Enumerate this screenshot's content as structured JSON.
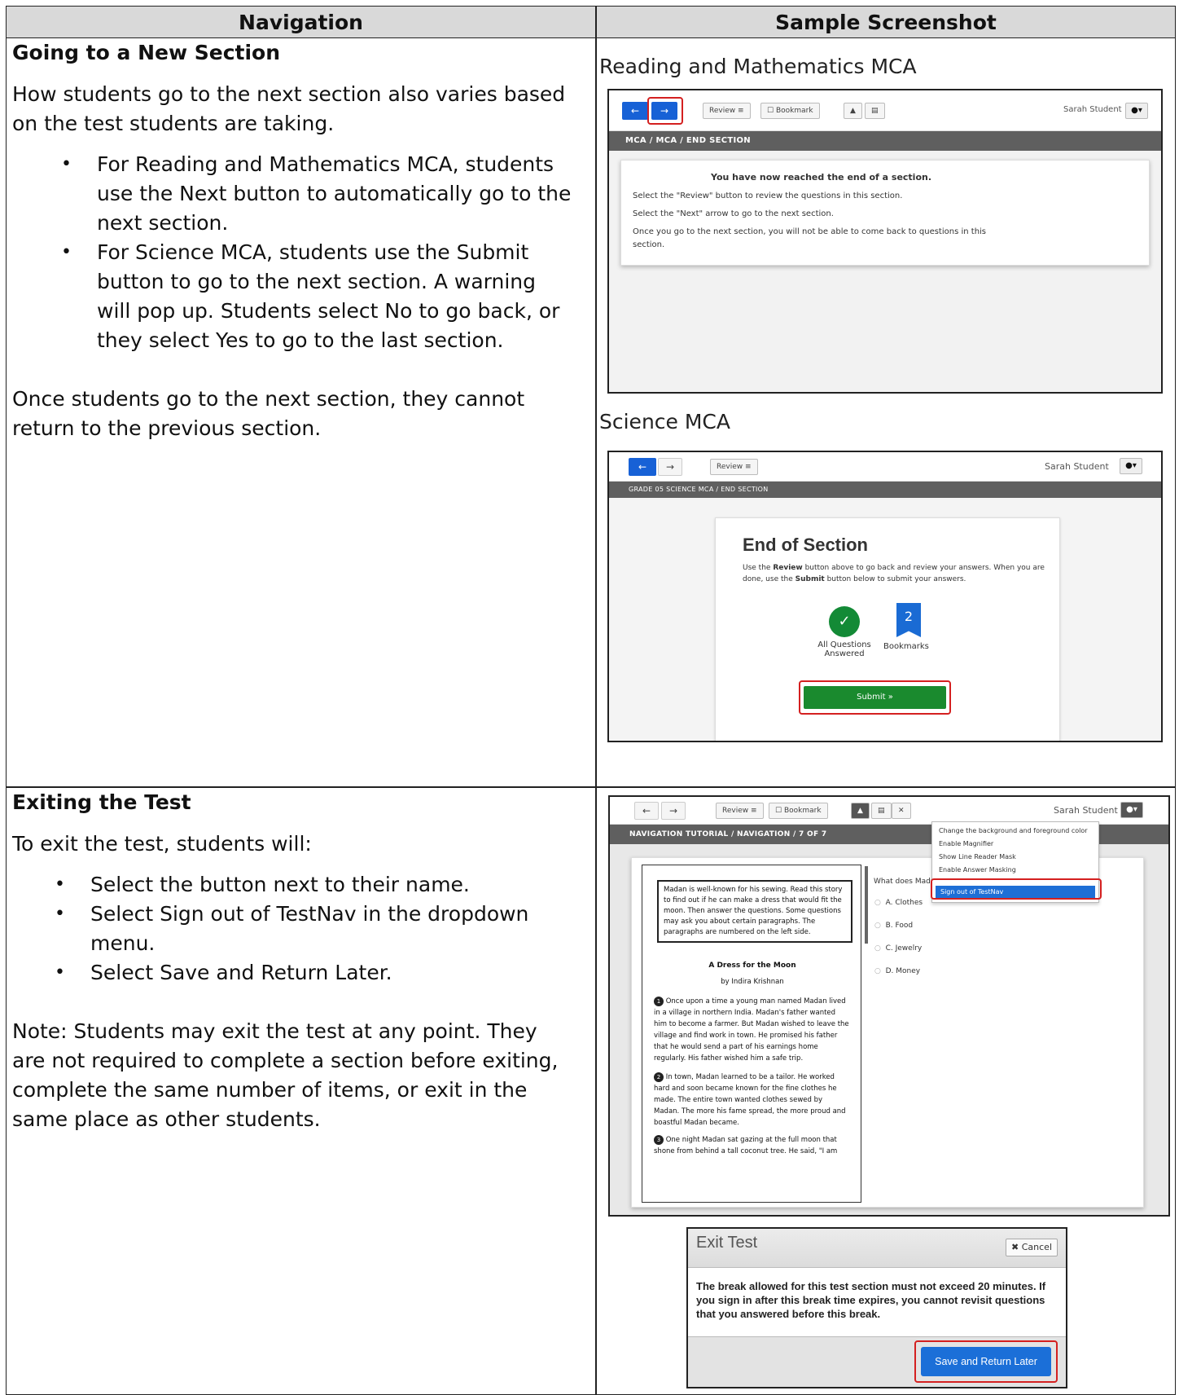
{
  "header": {
    "col1": "Navigation",
    "col2": "Sample Screenshot"
  },
  "section1": {
    "title": "Going to a New Section",
    "intro": "How students go to the next section also varies based on the test students are taking.",
    "bullets": [
      "For Reading and Mathematics MCA, students use the Next button to automatically go to the next section.",
      "For Science MCA, students use the Submit button to go to the next section. A warning will pop up. Students select No to go back, or they select Yes to go to the last section."
    ],
    "outro": "Once students go to the next section, they cannot return to the previous section.",
    "caption1": "Reading and Mathematics MCA",
    "caption2": "Science MCA"
  },
  "shot1": {
    "review": "Review",
    "bookmark": "Bookmark",
    "user": "Sarah Student",
    "breadcrumb": "MCA / MCA / END SECTION",
    "title": "You have now reached the end of a section.",
    "line1": "Select the \"Review\" button to review the questions in this section.",
    "line2": "Select the \"Next\" arrow to go to the next section.",
    "line3": "Once you go to the next section, you will not be able to come back to questions in this",
    "line4": "section."
  },
  "shot2": {
    "review": "Review",
    "user": "Sarah Student",
    "breadcrumb": "GRADE 05 SCIENCE MCA / END SECTION",
    "title": "End of Section",
    "line1_pre": "Use the ",
    "line1_b": "Review",
    "line1_post": " button above to go back and review your answers. When you are",
    "line2_pre": "done, use the ",
    "line2_b": "Submit",
    "line2_post": " button below to submit your answers.",
    "stat1": "All Questions Answered",
    "bookmarks_count": "2",
    "stat2": "Bookmarks",
    "submit": "Submit"
  },
  "section2": {
    "title": "Exiting the Test",
    "intro": "To exit the test, students will:",
    "bullets": [
      "Select the button next to their name.",
      "Select Sign out of TestNav in the dropdown menu.",
      "Select Save and Return Later."
    ],
    "note": "Note: Students may exit the test at any point. They are not required to complete a section before exiting, complete the same number of items, or exit in the same place as other students."
  },
  "shot3": {
    "review": "Review",
    "bookmark": "Bookmark",
    "user": "Sarah Student",
    "breadcrumb": "NAVIGATION TUTORIAL / NAVIGATION / 7 OF 7",
    "menu": [
      "Change the background and foreground color",
      "Enable Magnifier",
      "Show Line Reader Mask",
      "Enable Answer Masking"
    ],
    "signout": "Sign out of TestNav",
    "passage_box": "Madan is well-known for his sewing. Read this story to find out if he can make a dress that would fit the moon. Then answer the questions. Some questions may ask you about certain paragraphs. The paragraphs are numbered on the left side.",
    "story_title": "A Dress for the Moon",
    "author": "by Indira Krishnan",
    "p1": "Once upon a time a young man named Madan lived in a village in northern India. Madan's father wanted him to become a farmer. But Madan wished to leave the village and find work in town. He promised his father that he would send a part of his earnings home regularly. His father wished him a safe trip.",
    "p2": "In town, Madan learned to be a tailor. He worked hard and soon became known for the fine clothes he made. The entire town wanted clothes sewed by Madan. The more his fame spread, the more proud and boastful Madan became.",
    "p3": "One night Madan sat gazing at the full moon that shone from behind a tall coconut tree. He said, \"I am",
    "question": "What does Madan",
    "options": [
      "A. Clothes",
      "B. Food",
      "C. Jewelry",
      "D. Money"
    ]
  },
  "dialog": {
    "title": "Exit Test",
    "cancel": "Cancel",
    "body": "The break allowed for this test section must not exceed 20 minutes. If you sign in after this break time expires, you cannot revisit questions that you answered before this break.",
    "save": "Save and Return Later"
  }
}
